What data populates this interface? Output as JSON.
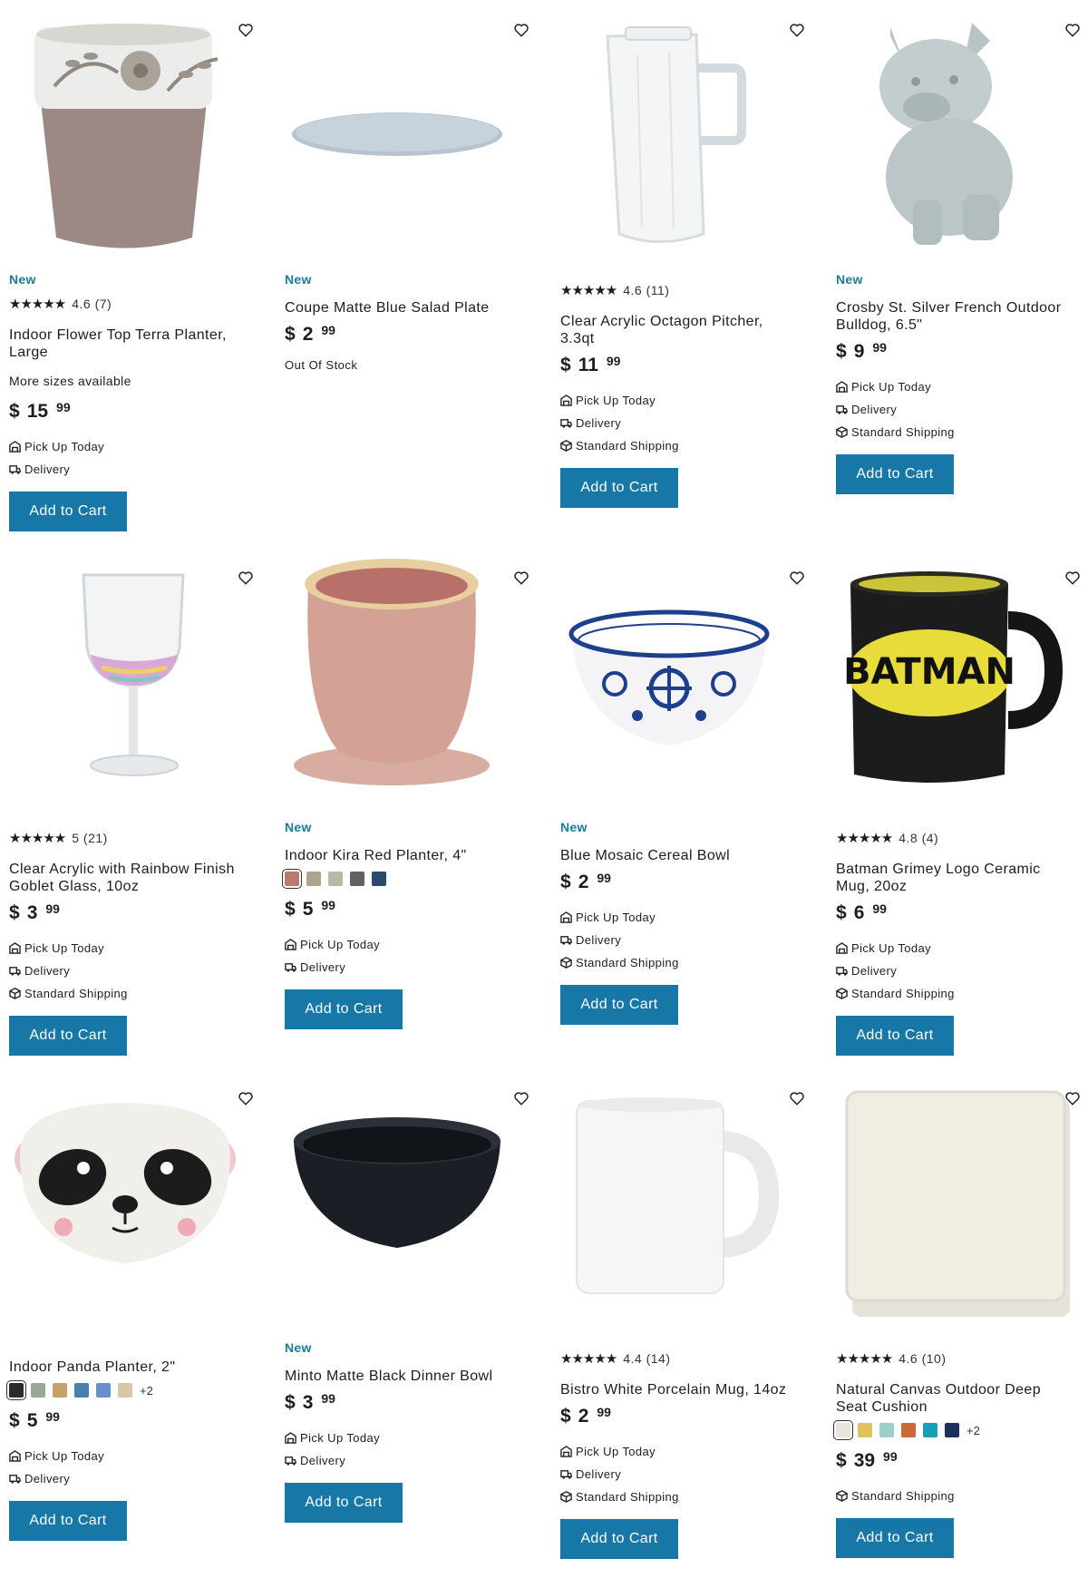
{
  "products": [
    {
      "id": "p1",
      "new": "New",
      "rating_text": "4.6 (7)",
      "stars": "★★★★★",
      "title": "Indoor Flower Top Terra Planter, Large",
      "more": "More sizes available",
      "price_symbol": "$",
      "price_dollars": "15",
      "price_cents": "99",
      "pickup": "Pick Up Today",
      "delivery": "Delivery",
      "button": "Add to Cart",
      "icon": "terra-planter"
    },
    {
      "id": "p2",
      "new": "New",
      "title": "Coupe Matte Blue Salad Plate",
      "price_symbol": "$",
      "price_dollars": "2",
      "price_cents": "99",
      "stock": "Out Of Stock",
      "icon": "blue-plate"
    },
    {
      "id": "p3",
      "rating_text": "4.6 (11)",
      "stars": "★★★★★",
      "title": "Clear Acrylic Octagon Pitcher, 3.3qt",
      "price_symbol": "$",
      "price_dollars": "11",
      "price_cents": "99",
      "pickup": "Pick Up Today",
      "delivery": "Delivery",
      "shipping": "Standard Shipping",
      "button": "Add to Cart",
      "icon": "pitcher"
    },
    {
      "id": "p4",
      "new": "New",
      "title": "Crosby St. Silver French Outdoor Bulldog, 6.5\"",
      "price_symbol": "$",
      "price_dollars": "9",
      "price_cents": "99",
      "pickup": "Pick Up Today",
      "delivery": "Delivery",
      "shipping": "Standard Shipping",
      "button": "Add to Cart",
      "icon": "bulldog"
    },
    {
      "id": "p5",
      "rating_text": "5 (21)",
      "stars": "★★★★★",
      "title": "Clear Acrylic with Rainbow Finish Goblet Glass, 10oz",
      "price_symbol": "$",
      "price_dollars": "3",
      "price_cents": "99",
      "pickup": "Pick Up Today",
      "delivery": "Delivery",
      "shipping": "Standard Shipping",
      "button": "Add to Cart",
      "icon": "goblet"
    },
    {
      "id": "p6",
      "new": "New",
      "title": "Indoor Kira Red Planter, 4\"",
      "swatches": [
        "#b87a6a",
        "#a9a58f",
        "#b7b8a6",
        "#5c6266",
        "#2a4a6d"
      ],
      "price_symbol": "$",
      "price_dollars": "5",
      "price_cents": "99",
      "pickup": "Pick Up Today",
      "delivery": "Delivery",
      "button": "Add to Cart",
      "icon": "kira-planter"
    },
    {
      "id": "p7",
      "new": "New",
      "title": "Blue Mosaic Cereal Bowl",
      "price_symbol": "$",
      "price_dollars": "2",
      "price_cents": "99",
      "pickup": "Pick Up Today",
      "delivery": "Delivery",
      "shipping": "Standard Shipping",
      "button": "Add to Cart",
      "icon": "mosaic-bowl"
    },
    {
      "id": "p8",
      "rating_text": "4.8 (4)",
      "stars": "★★★★★",
      "title": "Batman Grimey Logo Ceramic Mug, 20oz",
      "price_symbol": "$",
      "price_dollars": "6",
      "price_cents": "99",
      "pickup": "Pick Up Today",
      "delivery": "Delivery",
      "shipping": "Standard Shipping",
      "button": "Add to Cart",
      "icon": "batman-mug",
      "mug_text": "BATMAN"
    },
    {
      "id": "p9",
      "title": "Indoor Panda Planter, 2\"",
      "swatches": [
        "#2b2b2b",
        "#9aa79a",
        "#c8a06a",
        "#4a7fb0",
        "#6a8fc8",
        "#d9c7a8"
      ],
      "swatch_more": "+2",
      "price_symbol": "$",
      "price_dollars": "5",
      "price_cents": "99",
      "pickup": "Pick Up Today",
      "delivery": "Delivery",
      "button": "Add to Cart",
      "icon": "panda-planter"
    },
    {
      "id": "p10",
      "new": "New",
      "title": "Minto Matte Black Dinner Bowl",
      "price_symbol": "$",
      "price_dollars": "3",
      "price_cents": "99",
      "pickup": "Pick Up Today",
      "delivery": "Delivery",
      "button": "Add to Cart",
      "icon": "black-bowl"
    },
    {
      "id": "p11",
      "rating_text": "4.4 (14)",
      "stars": "★★★★★",
      "title": "Bistro White Porcelain Mug, 14oz",
      "price_symbol": "$",
      "price_dollars": "2",
      "price_cents": "99",
      "pickup": "Pick Up Today",
      "delivery": "Delivery",
      "shipping": "Standard Shipping",
      "button": "Add to Cart",
      "icon": "white-mug"
    },
    {
      "id": "p12",
      "rating_text": "4.6 (10)",
      "stars": "★★★★★",
      "title": "Natural Canvas Outdoor Deep Seat Cushion",
      "swatches": [
        "#e8e4da",
        "#e0c25a",
        "#9ccfc9",
        "#c8693a",
        "#1b9db6",
        "#1d2f5c"
      ],
      "swatch_more": "+2",
      "price_symbol": "$",
      "price_dollars": "39",
      "price_cents": "99",
      "shipping": "Standard Shipping",
      "button": "Add to Cart",
      "icon": "cushion"
    }
  ],
  "colors": {
    "accent": "#1777a6",
    "new_label": "#1a7d99"
  }
}
